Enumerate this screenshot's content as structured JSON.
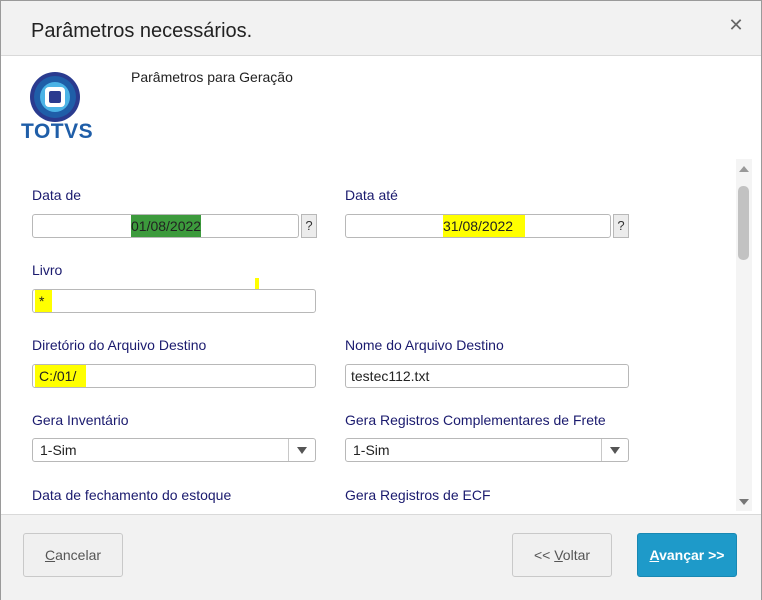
{
  "dialog": {
    "title": "Parâmetros necessários.",
    "close_icon": "close-icon"
  },
  "brand": {
    "logo_text": "TOTVS",
    "logo_colors": [
      "#1f5ea8",
      "#2a3b8f",
      "#4bb3e6"
    ]
  },
  "subtitle": "Parâmetros para Geração",
  "form": {
    "data_de": {
      "label": "Data de",
      "value": "01/08/2022",
      "help": "?"
    },
    "data_ate": {
      "label": "Data até",
      "value": "31/08/2022",
      "help": "?"
    },
    "livro": {
      "label": "Livro",
      "value": "*"
    },
    "diretorio": {
      "label": "Diretório do Arquivo Destino",
      "value": "C:/01/"
    },
    "nome_arquivo": {
      "label": "Nome do Arquivo Destino",
      "value": "testec112.txt"
    },
    "gera_inventario": {
      "label": "Gera Inventário",
      "value": "1-Sim"
    },
    "gera_frete": {
      "label": "Gera Registros Complementares de Frete",
      "value": "1-Sim"
    },
    "data_fechamento": {
      "label": "Data de fechamento do estoque"
    },
    "gera_ecf": {
      "label": "Gera Registros de ECF"
    }
  },
  "footer": {
    "cancelar": {
      "first": "C",
      "rest": "ancelar"
    },
    "voltar": {
      "prefix": "<< ",
      "first": "V",
      "rest": "oltar"
    },
    "avancar": {
      "first": "A",
      "rest": "vançar >>"
    }
  },
  "colors": {
    "accent": "#1e9ac9",
    "label": "#1a1a6e",
    "highlight_yellow": "#ffff00",
    "highlight_green": "#3c9a3c"
  }
}
